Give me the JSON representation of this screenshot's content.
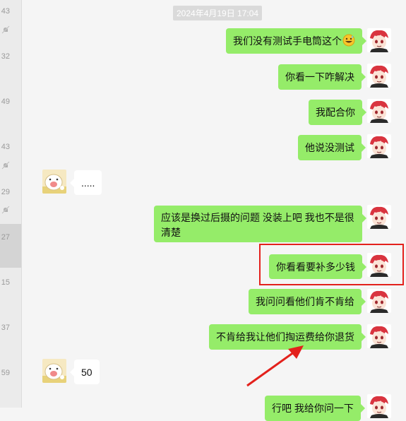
{
  "timestamp": "2024年4月19日 17:04",
  "sidebar_times": [
    "43",
    "32",
    "49",
    "43",
    "29",
    "27",
    "15",
    "37",
    "59"
  ],
  "messages": [
    {
      "side": "out",
      "text": "我们没有测试手电筒这个"
    },
    {
      "side": "out",
      "text": "你看一下咋解决"
    },
    {
      "side": "out",
      "text": "我配合你"
    },
    {
      "side": "out",
      "text": "他说没测试"
    },
    {
      "side": "in",
      "text": "....."
    },
    {
      "side": "out",
      "text": "应该是换过后摄的问题 没装上吧 我也不是很清楚"
    },
    {
      "side": "out",
      "text": "你看看要补多少钱"
    },
    {
      "side": "out",
      "text": "我问问看他们肯不肯给"
    },
    {
      "side": "out",
      "text": "不肯给我让他们掏运费给你退货"
    },
    {
      "side": "in",
      "text": "50"
    },
    {
      "side": "out",
      "text": "行吧 我给你问一下"
    }
  ],
  "icons": {
    "emoji": "grin-sweat-emoji-icon",
    "mute": "bell-slash-icon",
    "arrow": "red-arrow-icon"
  },
  "colors": {
    "bubble_out": "#95ec69",
    "bubble_in": "#ffffff",
    "highlight": "#e3211c"
  }
}
